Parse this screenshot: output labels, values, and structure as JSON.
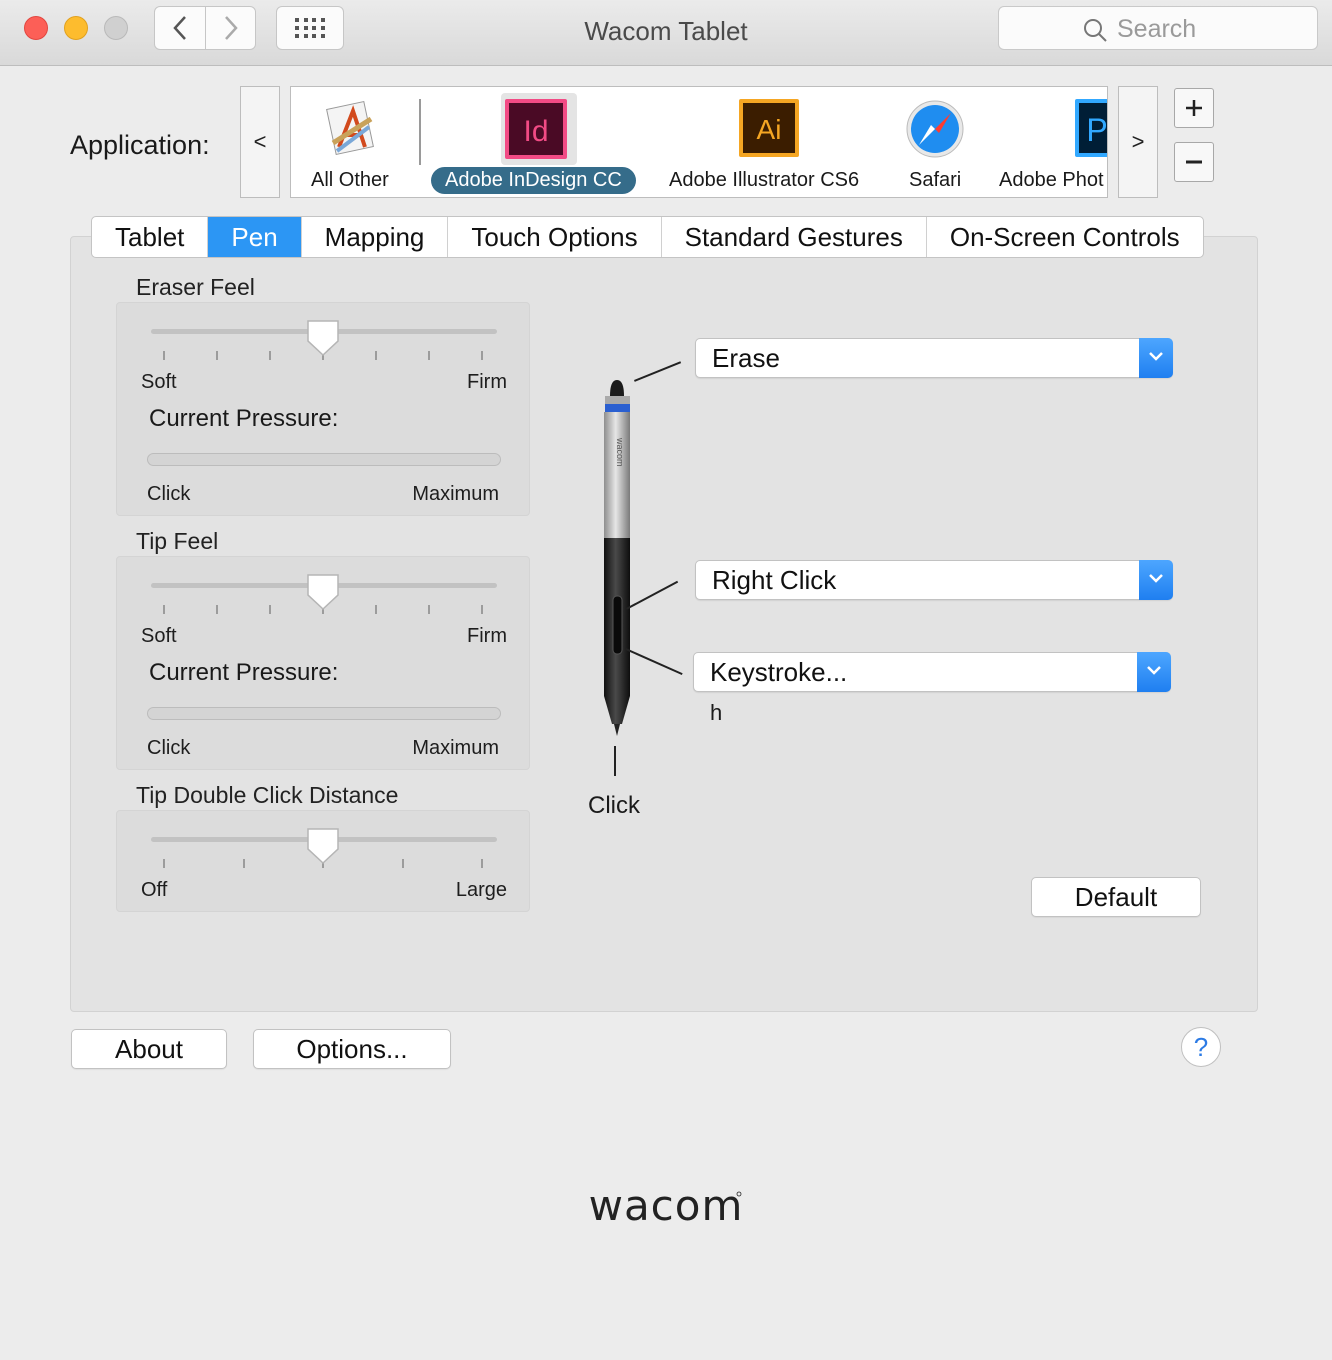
{
  "window": {
    "title": "Wacom Tablet",
    "search_placeholder": "Search"
  },
  "application": {
    "label": "Application:",
    "scroll_left": "<",
    "scroll_right": ">",
    "items": [
      {
        "name": "All Other",
        "icon": "all-other-icon",
        "selected": false
      },
      {
        "name": "Adobe InDesign CC",
        "icon": "indesign-icon",
        "icon_text": "Id",
        "selected": true
      },
      {
        "name": "Adobe Illustrator CS6",
        "icon": "illustrator-icon",
        "icon_text": "Ai",
        "selected": false
      },
      {
        "name": "Safari",
        "icon": "safari-icon",
        "selected": false
      },
      {
        "name": "Adobe Phot",
        "icon": "photoshop-icon",
        "icon_text": "P",
        "selected": false
      }
    ]
  },
  "tabs": [
    {
      "label": "Tablet",
      "active": false
    },
    {
      "label": "Pen",
      "active": true
    },
    {
      "label": "Mapping",
      "active": false
    },
    {
      "label": "Touch Options",
      "active": false
    },
    {
      "label": "Standard Gestures",
      "active": false
    },
    {
      "label": "On-Screen Controls",
      "active": false
    }
  ],
  "eraser_feel": {
    "title": "Eraser Feel",
    "min_label": "Soft",
    "max_label": "Firm",
    "level": 0.5,
    "pressure_title": "Current Pressure:",
    "pressure_min": "Click",
    "pressure_max": "Maximum"
  },
  "tip_feel": {
    "title": "Tip Feel",
    "min_label": "Soft",
    "max_label": "Firm",
    "level": 0.5,
    "pressure_title": "Current Pressure:",
    "pressure_min": "Click",
    "pressure_max": "Maximum"
  },
  "double_click": {
    "title": "Tip Double Click Distance",
    "min_label": "Off",
    "max_label": "Large",
    "level": 0.5
  },
  "pen": {
    "eraser_action": "Erase",
    "upper_button_action": "Right Click",
    "lower_button_action": "Keystroke...",
    "keystroke_value": "h",
    "tip_action": "Click",
    "brand_on_pen": "wacom"
  },
  "buttons": {
    "default": "Default",
    "about": "About",
    "options": "Options...",
    "help": "?"
  },
  "brand": "wacom",
  "colors": {
    "accent": "#2c96f4",
    "selected_app": "#356c8a",
    "close": "#fc5f57",
    "minimize": "#fdbc2e"
  }
}
